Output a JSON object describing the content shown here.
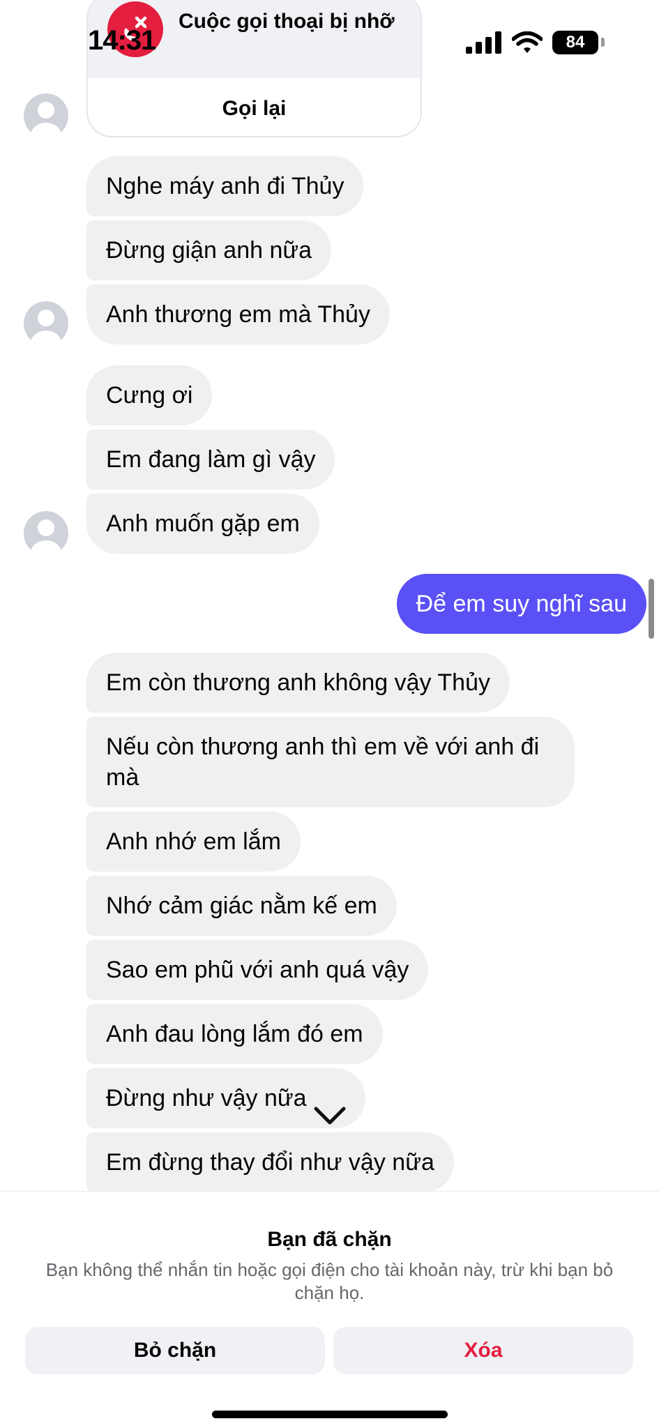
{
  "status_bar": {
    "time": "14:31",
    "battery": "84"
  },
  "call_card": {
    "title": "Cuộc gọi thoại bị nhỡ",
    "action": "Gọi lại"
  },
  "messages": [
    "Nghe máy anh đi Thủy",
    "Đừng giận anh nữa",
    "Anh thương em mà Thủy",
    "Cưng ơi",
    "Em đang làm gì vậy",
    "Anh muốn gặp em",
    "Để em suy nghĩ sau",
    "Em còn thương anh không vậy Thủy",
    "Nếu còn thương anh thì em về với anh đi",
    "mà",
    "Anh nhớ em lắm",
    "Nhớ cảm giác nằm kế em",
    "Sao em phũ với anh quá vậy",
    "Anh đau lòng lắm đó em",
    "Đừng như vậy nữa",
    "Em đừng thay đổi như vậy nữa"
  ],
  "blocked": {
    "title": "Bạn đã chặn",
    "description": "Bạn không thể nhắn tin hoặc gọi điện cho tài khoản này, trừ khi bạn bỏ chặn họ.",
    "unblock_label": "Bỏ chặn",
    "delete_label": "Xóa"
  },
  "colors": {
    "outgoing_bubble": "#5a50f5",
    "incoming_bubble": "#f0f0f2",
    "danger": "#e41e3f"
  },
  "icons": [
    "missed-call-icon",
    "signal-icon",
    "wifi-icon",
    "battery-icon",
    "avatar-placeholder-icon",
    "chevron-down-icon"
  ]
}
